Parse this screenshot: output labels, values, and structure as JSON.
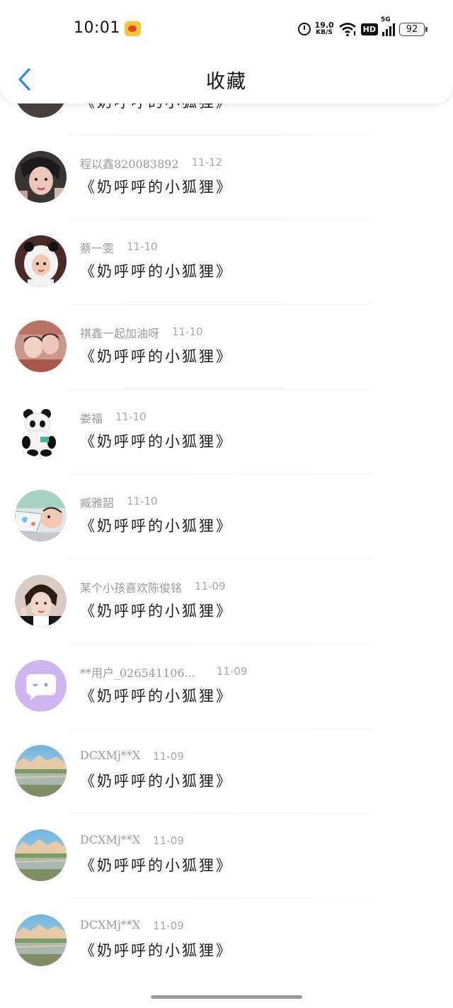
{
  "status": {
    "time": "10:01",
    "net_speed": "19.0",
    "net_unit": "KB/S",
    "hd": "HD",
    "signal_label": "5G",
    "battery": "92"
  },
  "header": {
    "title": "收藏"
  },
  "items": [
    {
      "name": "",
      "date": "",
      "message": "《奶呼呼的小狐狸》",
      "avatar": "photo-dark"
    },
    {
      "name": "程以鑫820083892",
      "date": "11-12",
      "message": "《奶呼呼的小狐狸》",
      "avatar": "photo-person"
    },
    {
      "name": "蔡一雯",
      "date": "11-10",
      "message": "《奶呼呼的小狐狸》",
      "avatar": "photo-panda-costume"
    },
    {
      "name": "祺鑫一起加油呀",
      "date": "11-10",
      "message": "《奶呼呼的小狐狸》",
      "avatar": "photo-couple"
    },
    {
      "name": "娄福",
      "date": "11-10",
      "message": "《奶呼呼的小狐狸》",
      "avatar": "panda-plush"
    },
    {
      "name": "臧雅韶",
      "date": "11-10",
      "message": "《奶呼呼的小狐狸》",
      "avatar": "cartoon"
    },
    {
      "name": "某个小孩喜欢陈俊铭",
      "date": "11-09",
      "message": "《奶呼呼的小狐狸》",
      "avatar": "photo-boy"
    },
    {
      "name": "**用户_026541106...",
      "date": "11-09",
      "message": "《奶呼呼的小狐狸》",
      "avatar": "default-chat"
    },
    {
      "name": "DCXMj**X",
      "date": "11-09",
      "message": "《奶呼呼的小狐狸》",
      "avatar": "landscape"
    },
    {
      "name": "DCXMj**X",
      "date": "11-09",
      "message": "《奶呼呼的小狐狸》",
      "avatar": "landscape"
    },
    {
      "name": "DCXMj**X",
      "date": "11-09",
      "message": "《奶呼呼的小狐狸》",
      "avatar": "landscape"
    }
  ]
}
